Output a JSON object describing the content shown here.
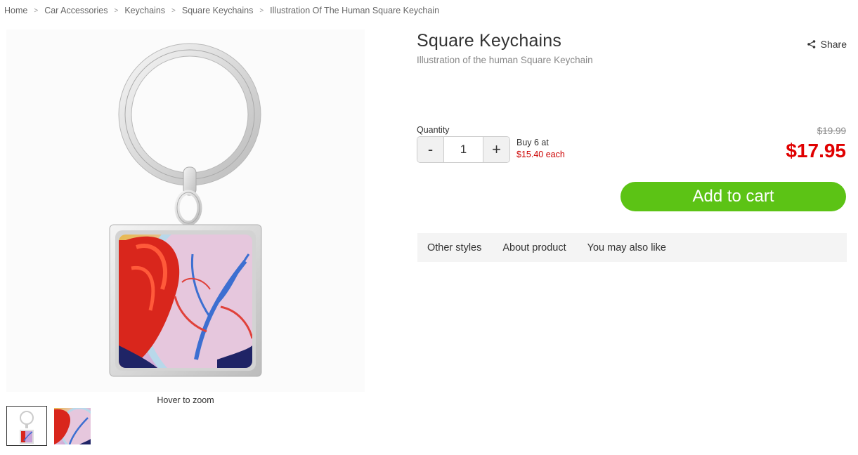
{
  "breadcrumb": {
    "items": [
      "Home",
      "Car Accessories",
      "Keychains",
      "Square Keychains",
      "Illustration Of The Human Square Keychain"
    ],
    "separator": ">"
  },
  "gallery": {
    "zoom_hint": "Hover to zoom",
    "thumbnails": [
      "keychain-full-view",
      "artwork-closeup"
    ]
  },
  "product": {
    "title": "Square Keychains",
    "subtitle": "Illustration of the human Square Keychain",
    "share_label": "Share"
  },
  "quantity": {
    "label": "Quantity",
    "value": "1",
    "minus": "-",
    "plus": "+"
  },
  "bulk_offer": {
    "line1": "Buy 6 at",
    "line2": "$15.40 each"
  },
  "price": {
    "original": "$19.99",
    "current": "$17.95"
  },
  "cart": {
    "button_label": "Add to cart"
  },
  "tabs": [
    "Other styles",
    "About product",
    "You may also like"
  ],
  "colors": {
    "accent_green": "#5cc315",
    "price_red": "#e00000",
    "bulk_red": "#cc0000"
  }
}
